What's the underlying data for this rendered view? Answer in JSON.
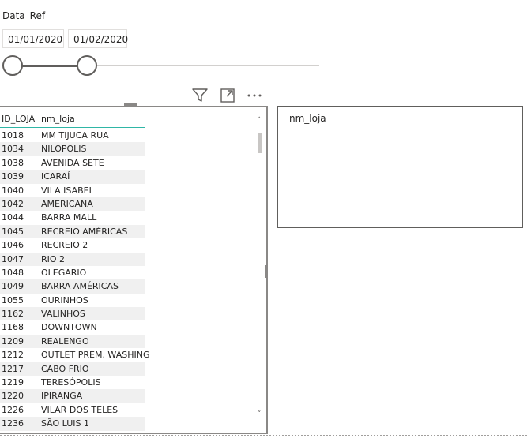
{
  "slicer": {
    "title": "Data_Ref",
    "start_date": "01/01/2020",
    "end_date": "01/02/2020",
    "range_fraction": [
      0,
      0.24
    ]
  },
  "visual_header": {
    "icons": [
      "filter-icon",
      "focus-mode-icon",
      "more-options-icon"
    ]
  },
  "table": {
    "columns": [
      "ID_LOJA",
      "nm_loja"
    ],
    "rows": [
      [
        "1018",
        "MM TIJUCA RUA"
      ],
      [
        "1034",
        "NILOPOLIS"
      ],
      [
        "1038",
        "AVENIDA SETE"
      ],
      [
        "1039",
        "ICARAÍ"
      ],
      [
        "1040",
        "VILA ISABEL"
      ],
      [
        "1042",
        "AMERICANA"
      ],
      [
        "1044",
        "BARRA MALL"
      ],
      [
        "1045",
        "RECREIO AMÉRICAS"
      ],
      [
        "1046",
        "RECREIO 2"
      ],
      [
        "1047",
        "RIO 2"
      ],
      [
        "1048",
        "OLEGARIO"
      ],
      [
        "1049",
        "BARRA AMÉRICAS"
      ],
      [
        "1055",
        "OURINHOS"
      ],
      [
        "1162",
        "VALINHOS"
      ],
      [
        "1168",
        "DOWNTOWN"
      ],
      [
        "1209",
        "REALENGO"
      ],
      [
        "1212",
        "OUTLET PREM. WASHING"
      ],
      [
        "1217",
        "CABO FRIO"
      ],
      [
        "1219",
        "TERESÓPOLIS"
      ],
      [
        "1220",
        "IPIRANGA"
      ],
      [
        "1226",
        "VILAR DOS TELES"
      ],
      [
        "1236",
        "SÃO LUIS 1"
      ]
    ],
    "scroll_up_glyph": "˄",
    "scroll_down_glyph": "˅"
  },
  "card": {
    "title": "nm_loja"
  },
  "colors": {
    "accent_line": "#2fb6a6",
    "border": "#8a8886",
    "stripe": "#f0f0f0",
    "text": "#252423"
  }
}
